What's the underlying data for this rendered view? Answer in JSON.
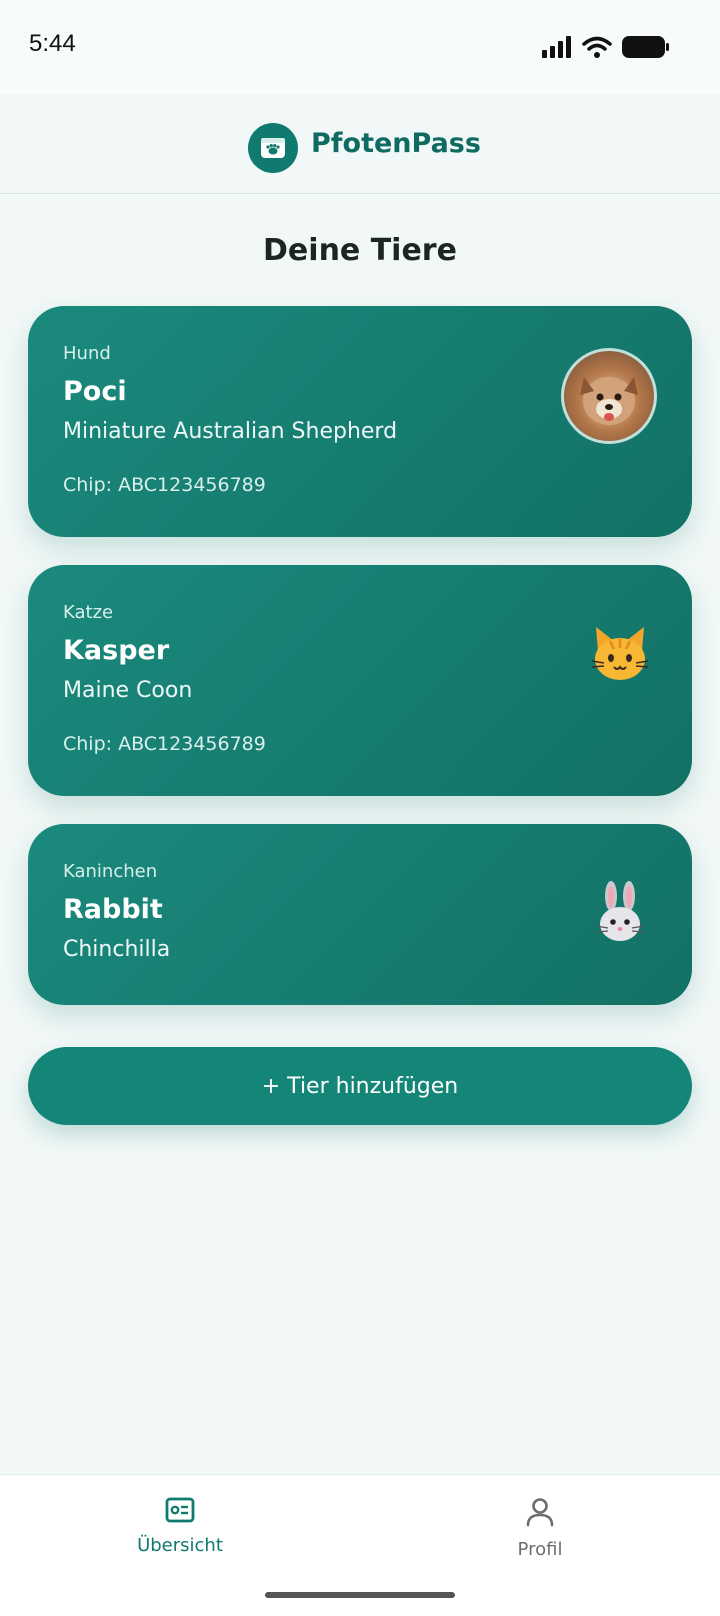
{
  "status_bar": {
    "time": "5:44"
  },
  "app": {
    "name": "PfotenPass"
  },
  "page": {
    "title": "Deine Tiere"
  },
  "pets": [
    {
      "species": "Hund",
      "name": "Poci",
      "breed": "Miniature Australian Shepherd",
      "chip": "Chip: ABC123456789",
      "avatar": "dog-photo"
    },
    {
      "species": "Katze",
      "name": "Kasper",
      "breed": "Maine Coon",
      "chip": "Chip: ABC123456789",
      "avatar": "cat-emoji-icon"
    },
    {
      "species": "Kaninchen",
      "name": "Rabbit",
      "breed": "Chinchilla",
      "avatar": "rabbit-emoji-icon"
    }
  ],
  "actions": {
    "add_pet": "+ Tier hinzufügen"
  },
  "nav": {
    "overview": {
      "label": "Übersicht",
      "icon": "id-card-icon"
    },
    "profile": {
      "label": "Profil",
      "icon": "user-icon"
    }
  },
  "colors": {
    "primary": "#148678",
    "primary_dark": "#0f6b61",
    "background": "#f1f8f7"
  }
}
